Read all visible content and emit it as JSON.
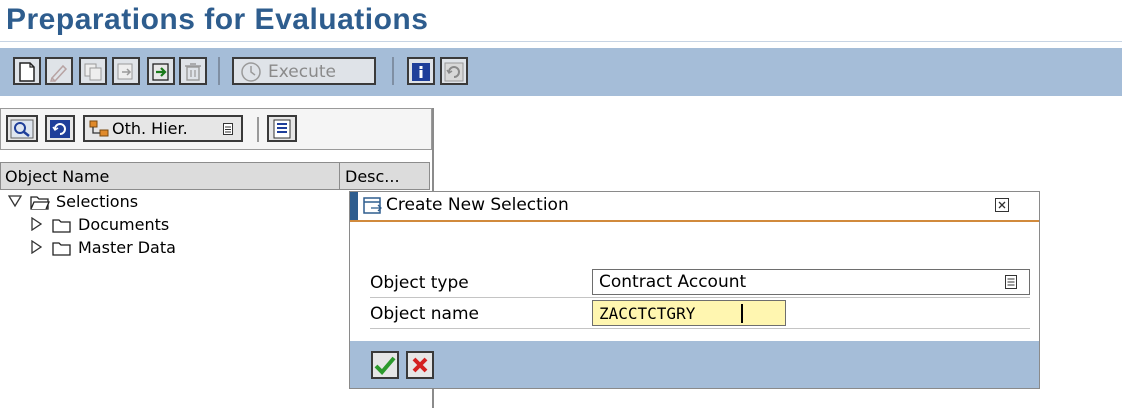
{
  "page": {
    "title": "Preparations for Evaluations"
  },
  "toolbar": {
    "buttons": [
      {
        "name": "new-icon"
      },
      {
        "name": "edit-icon"
      },
      {
        "name": "copy-icon"
      },
      {
        "name": "transport-icon"
      },
      {
        "name": "import-icon"
      },
      {
        "name": "delete-icon"
      }
    ],
    "execute_label": "Execute",
    "info_icon": "info-icon",
    "refresh_icon": "refresh-icon"
  },
  "tree_toolbar": {
    "find_icon": "find-icon",
    "refresh_icon": "refresh-icon",
    "other_hierarchy_label": "Oth. Hier.",
    "layout_icon": "layout-icon"
  },
  "tree": {
    "col_object_name": "Object Name",
    "col_description": "Desc...",
    "items": [
      {
        "label": "Selections",
        "expanded": true,
        "level": 0
      },
      {
        "label": "Documents",
        "expanded": false,
        "level": 1
      },
      {
        "label": "Master Data",
        "expanded": false,
        "level": 1
      }
    ]
  },
  "dialog": {
    "title": "Create New Selection",
    "object_type_label": "Object type",
    "object_type_value": "Contract Account",
    "object_name_label": "Object name",
    "object_name_value": "ZACCTCTGRY",
    "confirm_icon": "checkmark-icon",
    "cancel_icon": "cancel-icon"
  },
  "colors": {
    "title": "#2e5d8e",
    "toolbar_bg": "#a5bdd8",
    "input_highlight": "#fff6b0",
    "confirm_green": "#2c9a2c",
    "cancel_red": "#d42020"
  }
}
